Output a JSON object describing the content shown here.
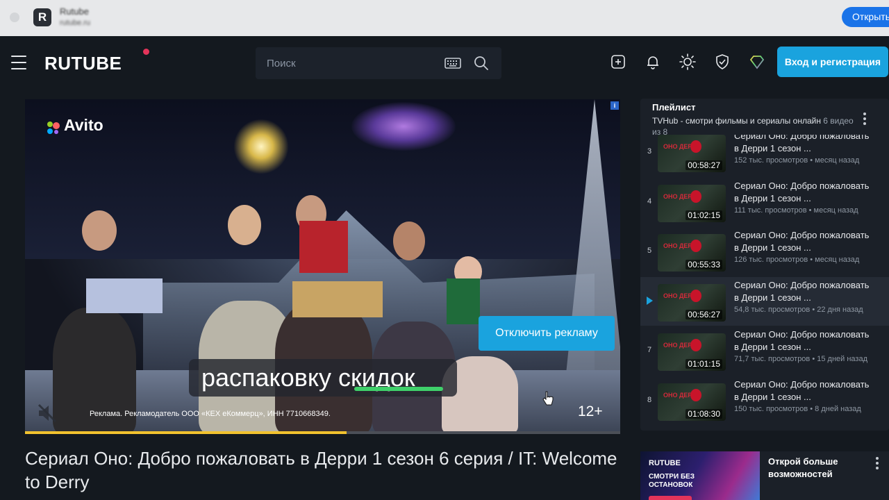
{
  "install_bar": {
    "app_name": "Rutube",
    "app_sub": "rutube.ru",
    "open_label": "Открыть"
  },
  "header": {
    "logo": "RUTUBE",
    "search_placeholder": "Поиск",
    "login_label": "Вход и регистрация"
  },
  "player": {
    "ad_brand": "Avito",
    "caption_part1": "распаковку ",
    "caption_part2": "скидок",
    "disable_ad_label": "Отключить рекламу",
    "ad_legal": "Реклама. Рекламодатель ООО «КЕХ еКоммерц», ИНН 7710668349.",
    "age_rating": "12+",
    "info_badge": "i",
    "progress": 0.54
  },
  "video": {
    "title": "Сериал Оно: Добро пожаловать в Дерри 1 сезон 6 серия / IT: Welcome to Derry"
  },
  "playlist": {
    "title": "Плейлист",
    "channel": "TVHub - смотри фильмы и сериалы онлайн",
    "count": "6 видео из 8",
    "items": [
      {
        "num": "3",
        "title": "Сериал Оно: Добро пожаловать в Дерри 1 сезон ...",
        "duration": "00:58:27",
        "meta": "152 тыс. просмотров • месяц назад",
        "active": false
      },
      {
        "num": "4",
        "title": "Сериал Оно: Добро пожаловать в Дерри 1 сезон ...",
        "duration": "01:02:15",
        "meta": "111 тыс. просмотров • месяц назад",
        "active": false
      },
      {
        "num": "5",
        "title": "Сериал Оно: Добро пожаловать в Дерри 1 сезон ...",
        "duration": "00:55:33",
        "meta": "126 тыс. просмотров • месяц назад",
        "active": false
      },
      {
        "num": "",
        "title": "Сериал Оно: Добро пожаловать в Дерри 1 сезон ...",
        "duration": "00:56:27",
        "meta": "54,8 тыс. просмотров • 22 дня назад",
        "active": true
      },
      {
        "num": "7",
        "title": "Сериал Оно: Добро пожаловать в Дерри 1 сезон ...",
        "duration": "01:01:15",
        "meta": "71,7 тыс. просмотров • 15 дней назад",
        "active": false
      },
      {
        "num": "8",
        "title": "Сериал Оно: Добро пожаловать в Дерри 1 сезон ...",
        "duration": "01:08:30",
        "meta": "150 тыс. просмотров • 8 дней назад",
        "active": false
      }
    ],
    "thumb_text": "ОНО ДЕРРИ"
  },
  "promo": {
    "logo": "RUTUBE",
    "slogan": "СМОТРИ БЕЗ ОСТАНОВОК",
    "text": "Открой больше возможностей"
  },
  "colors": {
    "accent": "#1aa3de",
    "progress": "#f2c22e",
    "background": "#14191f"
  }
}
